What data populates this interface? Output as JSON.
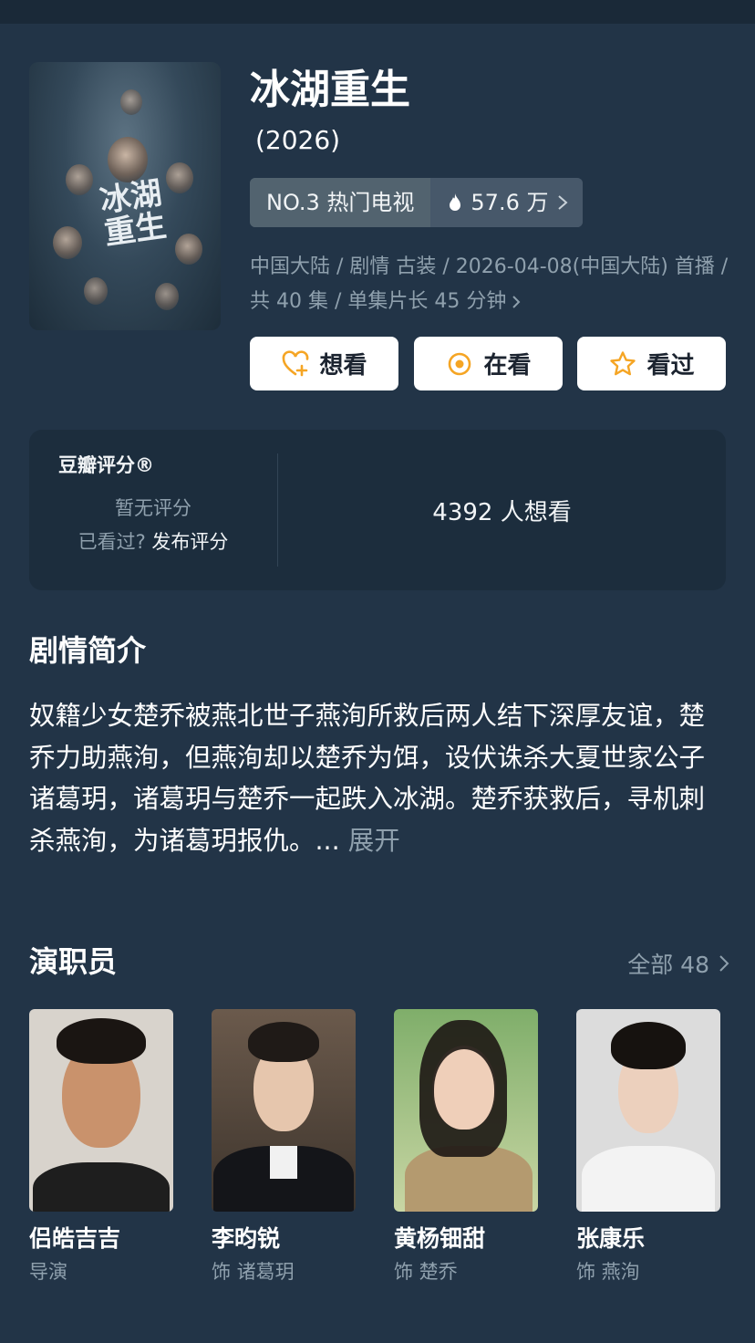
{
  "movie": {
    "title": "冰湖重生",
    "year": "(2026)",
    "rank": "NO.3 热门电视",
    "heat": "57.6 万",
    "poster_title": "冰湖重生",
    "meta": "中国大陆 / 剧情 古装 / 2026-04-08(中国大陆) 首播 / 共 40 集 / 单集片长 45 分钟"
  },
  "actions": {
    "want": "想看",
    "watching": "在看",
    "watched": "看过"
  },
  "rating": {
    "title": "豆瓣评分®",
    "none": "暂无评分",
    "seen_prompt": "已看过?",
    "rate_link": "发布评分",
    "want_count": "4392 人想看"
  },
  "synopsis": {
    "heading": "剧情简介",
    "text": "奴籍少女楚乔被燕北世子燕洵所救后两人结下深厚友谊，楚乔力助燕洵，但燕洵却以楚乔为饵，设伏诛杀大夏世家公子诸葛玥，诸葛玥与楚乔一起跌入冰湖。楚乔获救后，寻机刺杀燕洵，为诸葛玥报仇。...",
    "more": "展开"
  },
  "cast": {
    "heading": "演职员",
    "all_label": "全部 48",
    "members": [
      {
        "name": "侣皓吉吉",
        "role": "导演"
      },
      {
        "name": "李昀锐",
        "role": "饰 诸葛玥"
      },
      {
        "name": "黄杨钿甜",
        "role": "饰 楚乔"
      },
      {
        "name": "张康乐",
        "role": "饰 燕洵"
      }
    ]
  },
  "colors": {
    "background": "#223447",
    "card": "#1c2d3d",
    "accent_yellow": "#f5a524"
  },
  "icons": [
    "heart-plus-icon",
    "target-icon",
    "star-icon",
    "flame-icon",
    "chevron-right-icon"
  ]
}
